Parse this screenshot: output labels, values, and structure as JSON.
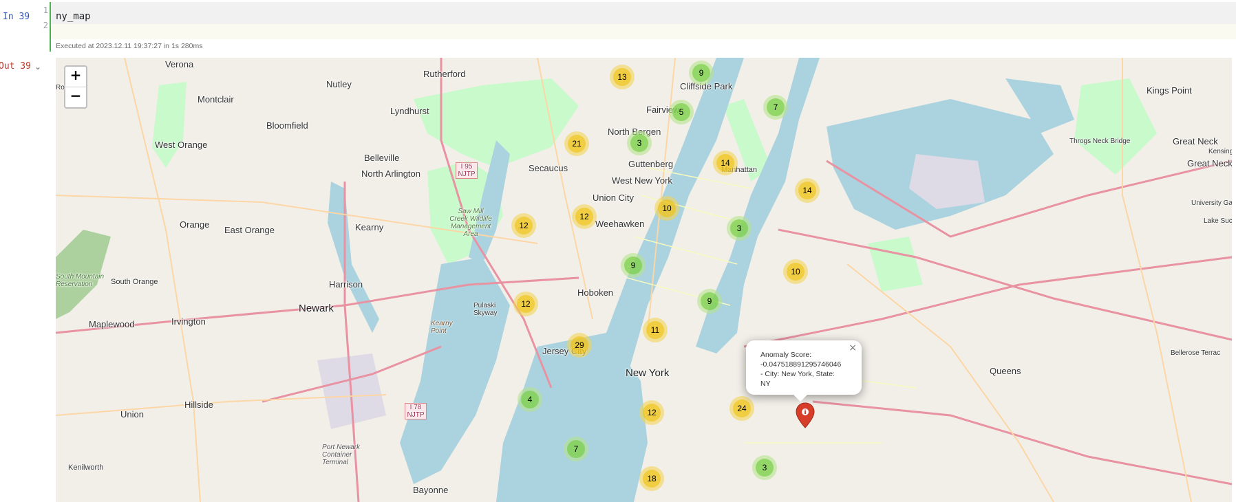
{
  "cell": {
    "in_label": "In 39",
    "line_numbers": [
      "1",
      "2"
    ],
    "code_line_1": "ny_map",
    "code_line_2": "",
    "executed": "Executed at 2023.12.11 19:37:27 in 1s 280ms",
    "out_label": "Out 39"
  },
  "map": {
    "zoom_in": "+",
    "zoom_out": "−",
    "places": {
      "verona": "Verona",
      "nutley": "Nutley",
      "rutherford": "Rutherford",
      "cliffside_park": "Cliffside Park",
      "montclair": "Montclair",
      "lyndhurst": "Lyndhurst",
      "fairview": "Fairview",
      "kings_point": "Kings Point",
      "bloomfield": "Bloomfield",
      "north_bergen": "North Bergen",
      "west_orange": "West Orange",
      "belleville": "Belleville",
      "north_arlington": "North Arlington",
      "secaucus": "Secaucus",
      "guttenberg": "Guttenberg",
      "west_new_york": "West New York",
      "manhattan": "Manhattan",
      "union_city": "Union City",
      "great_neck": "Great Neck",
      "great_neck_plaza": "Great Neck Plaza",
      "throgs_neck_bridge": "Throgs Neck Bridge",
      "orange": "Orange",
      "east_orange": "East Orange",
      "kearny": "Kearny",
      "weehawken": "Weehawken",
      "south_orange": "South Orange",
      "south_mountain_reservation": "South Mountain Reservation",
      "harrison": "Harrison",
      "newark": "Newark",
      "hoboken": "Hoboken",
      "pulaski_skyway": "Pulaski Skyway",
      "maplewood": "Maplewood",
      "irvington": "Irvington",
      "kearny_point": "Kearny Point",
      "jersey_city": "Jersey City",
      "new_york": "New York",
      "queens": "Queens",
      "hillside": "Hillside",
      "union": "Union",
      "port_newark": "Port Newark Container Terminal",
      "bayonne": "Bayonne",
      "kenilworth": "Kenilworth",
      "lake_success": "Lake Success",
      "university_gardens": "University Gar",
      "bellerose_terrace": "Bellerose Terrac",
      "sawmill_creek": "Saw Mill Creek Wildlife Management Area",
      "i95_shield": "I 95 NJTP",
      "i78_shield": "I 78 NJTP",
      "kensington": "Kensingto",
      "roseland": "Ro"
    },
    "clusters": [
      {
        "count": "13",
        "color": "yellow"
      },
      {
        "count": "9",
        "color": "green"
      },
      {
        "count": "5",
        "color": "green"
      },
      {
        "count": "7",
        "color": "green"
      },
      {
        "count": "21",
        "color": "yellow"
      },
      {
        "count": "3",
        "color": "green"
      },
      {
        "count": "14",
        "color": "yellow"
      },
      {
        "count": "14",
        "color": "yellow"
      },
      {
        "count": "12",
        "color": "yellow"
      },
      {
        "count": "10",
        "color": "yellow"
      },
      {
        "count": "12",
        "color": "yellow"
      },
      {
        "count": "3",
        "color": "green"
      },
      {
        "count": "9",
        "color": "green"
      },
      {
        "count": "10",
        "color": "yellow"
      },
      {
        "count": "12",
        "color": "yellow"
      },
      {
        "count": "9",
        "color": "green"
      },
      {
        "count": "11",
        "color": "yellow"
      },
      {
        "count": "29",
        "color": "yellow"
      },
      {
        "count": "4",
        "color": "green"
      },
      {
        "count": "12",
        "color": "yellow"
      },
      {
        "count": "24",
        "color": "yellow"
      },
      {
        "count": "7",
        "color": "green"
      },
      {
        "count": "3",
        "color": "green"
      },
      {
        "count": "18",
        "color": "yellow"
      }
    ],
    "popup": {
      "line1": "Anomaly Score:",
      "line2": "-0.047518891295746046",
      "line3": "- City: New York, State:",
      "line4": "NY",
      "close": "×"
    },
    "marker_icon": "info-sign-icon",
    "colors": {
      "marker": "#d63e2a",
      "water": "#aad3df",
      "park": "#c8facc"
    }
  }
}
